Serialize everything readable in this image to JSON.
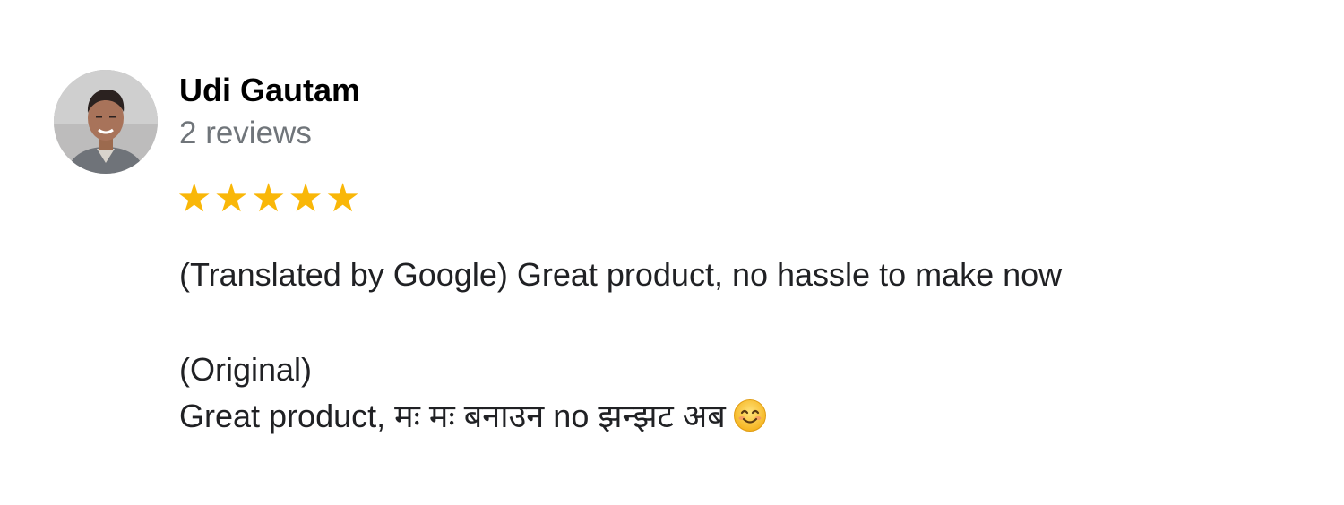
{
  "review": {
    "author": "Udi Gautam",
    "review_count": "2 reviews",
    "rating": 5,
    "stars": [
      "★",
      "★",
      "★",
      "★",
      "★"
    ],
    "translated_text": "(Translated by Google) Great product, no hassle to make now",
    "original_label": "(Original)",
    "original_text": "Great product, मः मः बनाउन no झन्झट अब",
    "emoji": "smiling-face-icon"
  },
  "colors": {
    "star": "#f9b708",
    "name": "#000000",
    "meta": "#70757a",
    "text": "#202124"
  }
}
